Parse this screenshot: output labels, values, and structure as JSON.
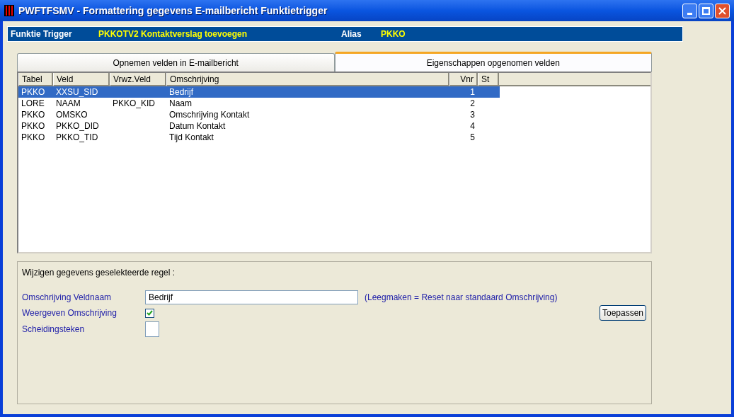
{
  "window": {
    "title": "PWFTFSMV - Formattering gegevens E-mailbericht Funktietrigger"
  },
  "header": {
    "label": "Funktie Trigger",
    "value": "PKKOTV2  Kontaktverslag toevoegen",
    "alias_label": "Alias",
    "alias_value": "PKKO"
  },
  "tabs": [
    {
      "label": "Opnemen velden in E-mailbericht",
      "selected": false
    },
    {
      "label": "Eigenschappen opgenomen velden",
      "selected": true
    }
  ],
  "table": {
    "columns": [
      "Tabel",
      "Veld",
      "Vrwz.Veld",
      "Omschrijving",
      "Vnr",
      "St"
    ],
    "rows": [
      {
        "cells": [
          "PKKO",
          "XXSU_SID",
          "",
          "Bedrijf",
          "1",
          ""
        ],
        "selected": true
      },
      {
        "cells": [
          "LORE",
          "NAAM",
          "PKKO_KID",
          "Naam",
          "2",
          ""
        ],
        "selected": false
      },
      {
        "cells": [
          "PKKO",
          "OMSKO",
          "",
          "Omschrijving Kontakt",
          "3",
          ""
        ],
        "selected": false
      },
      {
        "cells": [
          "PKKO",
          "PKKO_DID",
          "",
          "Datum Kontakt",
          "4",
          ""
        ],
        "selected": false
      },
      {
        "cells": [
          "PKKO",
          "PKKO_TID",
          "",
          "Tijd Kontakt",
          "5",
          ""
        ],
        "selected": false
      }
    ]
  },
  "edit": {
    "title": "Wijzigen gegevens geselekteerde regel :",
    "description_label": "Omschrijving Veldnaam",
    "description_value": "Bedrijf",
    "description_hint": "(Leegmaken = Reset naar standaard Omschrijving)",
    "show_label": "Weergeven Omschrijving",
    "show_checked": true,
    "separator_label": "Scheidingsteken",
    "apply_button": "Toepassen"
  }
}
